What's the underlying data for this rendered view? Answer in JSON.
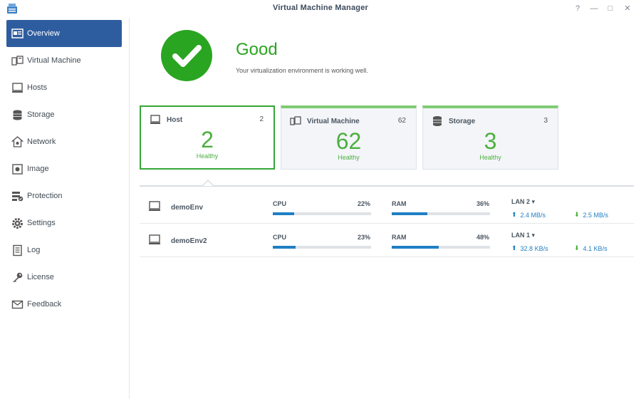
{
  "window": {
    "title": "Virtual Machine Manager",
    "controls": [
      "?",
      "—",
      "□",
      "✕"
    ]
  },
  "sidebar": {
    "items": [
      {
        "label": "Overview",
        "icon": "overview-icon",
        "active": true
      },
      {
        "label": "Virtual Machine",
        "icon": "virtual-machine-icon"
      },
      {
        "label": "Hosts",
        "icon": "hosts-icon"
      },
      {
        "label": "Storage",
        "icon": "storage-icon"
      },
      {
        "label": "Network",
        "icon": "network-icon"
      },
      {
        "label": "Image",
        "icon": "image-icon"
      },
      {
        "label": "Protection",
        "icon": "protection-icon"
      },
      {
        "label": "Settings",
        "icon": "settings-icon"
      },
      {
        "label": "Log",
        "icon": "log-icon"
      },
      {
        "label": "License",
        "icon": "license-icon"
      },
      {
        "label": "Feedback",
        "icon": "feedback-icon"
      }
    ]
  },
  "status": {
    "title": "Good",
    "message": "Your virtualization environment is working well.",
    "color": "#2aa521"
  },
  "cards": [
    {
      "title": "Host",
      "count": "2",
      "big": "2",
      "health": "Healthy",
      "icon": "host-icon",
      "selected": true
    },
    {
      "title": "Virtual Machine",
      "count": "62",
      "big": "62",
      "health": "Healthy",
      "icon": "virtual-machine-icon"
    },
    {
      "title": "Storage",
      "count": "3",
      "big": "3",
      "health": "Healthy",
      "icon": "storage-icon"
    }
  ],
  "hosts": [
    {
      "name": "demoEnv",
      "cpu_label": "CPU",
      "cpu_value": "22%",
      "cpu_fraction": 0.22,
      "ram_label": "RAM",
      "ram_value": "36%",
      "ram_fraction": 0.36,
      "lan": "LAN 2",
      "upload": "2.4 MB/s",
      "download": "2.5 MB/s"
    },
    {
      "name": "demoEnv2",
      "cpu_label": "CPU",
      "cpu_value": "23%",
      "cpu_fraction": 0.23,
      "ram_label": "RAM",
      "ram_value": "48%",
      "ram_fraction": 0.48,
      "lan": "LAN 1",
      "upload": "32.8 KB/s",
      "download": "4.1 KB/s"
    }
  ],
  "colors": {
    "accent": "#2e5d9f",
    "healthy": "#4caf3f",
    "bar": "#1f7fc4"
  }
}
